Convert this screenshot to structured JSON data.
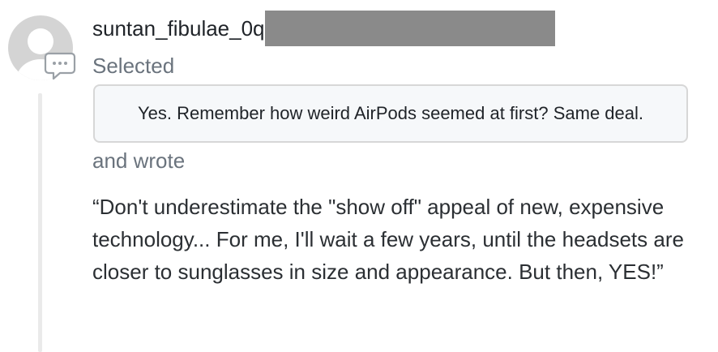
{
  "comment": {
    "username": "suntan_fibulae_0q",
    "selected_label": "Selected",
    "selected_text": "Yes. Remember how weird AirPods seemed at first? Same deal.",
    "action_label": "and wrote",
    "quote": "“Don't underestimate the \"show off\" appeal of new, expensive technology... For me, I'll wait a few years, until the headsets are closer to sunglasses in size and appearance. But then, YES!”"
  },
  "icons": {
    "avatar": "default-user-avatar-icon",
    "badge": "comment-bubble-icon"
  },
  "colors": {
    "avatar": "#d4d4d4",
    "muted_text": "#6a737d",
    "redaction": "#8a8a8a",
    "selected_box_bg": "#f6f8fa",
    "selected_box_border": "#d7d7d7",
    "thread_line": "#eaeaea"
  }
}
